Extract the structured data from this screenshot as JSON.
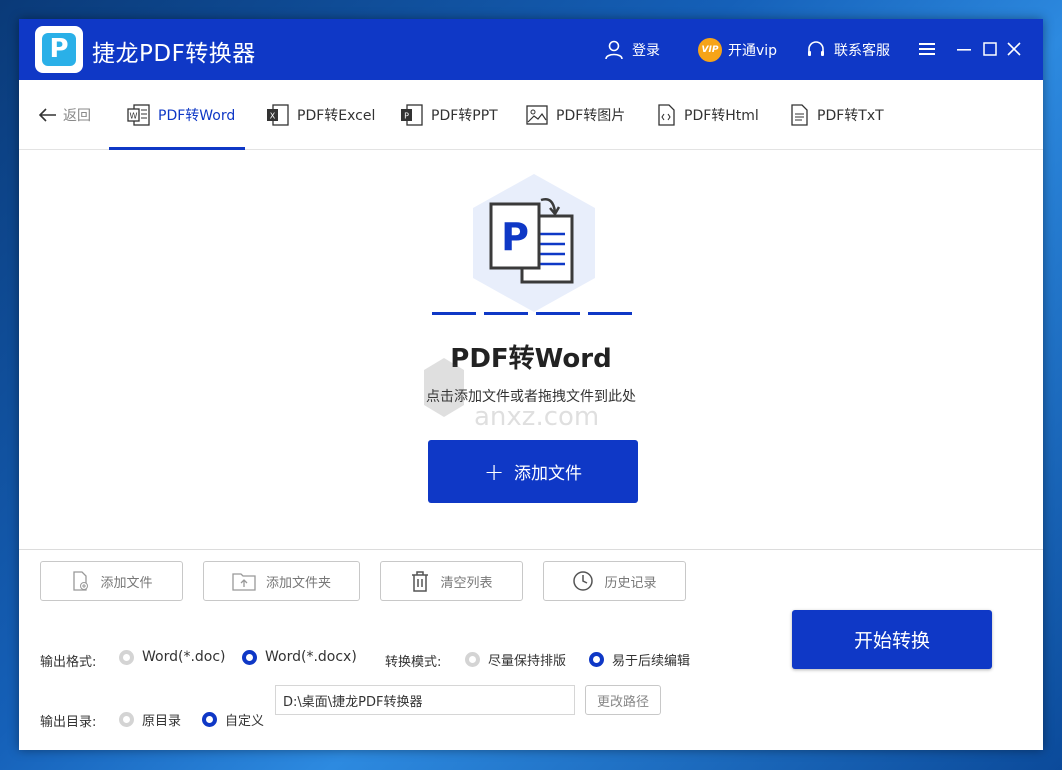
{
  "app": {
    "title": "捷龙PDF转换器",
    "logo_letter": "P"
  },
  "titlebar": {
    "login": "登录",
    "vip_badge": "VIP",
    "vip": "开通vip",
    "support": "联系客服"
  },
  "tabs": {
    "back": "返回",
    "items": [
      {
        "label": "PDF转Word",
        "icon": "word-icon",
        "active": true
      },
      {
        "label": "PDF转Excel",
        "icon": "excel-icon"
      },
      {
        "label": "PDF转PPT",
        "icon": "ppt-icon"
      },
      {
        "label": "PDF转图片",
        "icon": "image-icon"
      },
      {
        "label": "PDF转Html",
        "icon": "html-icon"
      },
      {
        "label": "PDF转TxT",
        "icon": "txt-icon"
      }
    ]
  },
  "drop": {
    "title": "PDF转Word",
    "subtitle": "点击添加文件或者拖拽文件到此处",
    "add_button": "添加文件",
    "watermark": "anxz.com"
  },
  "toolbar": {
    "add_file": "添加文件",
    "add_folder": "添加文件夹",
    "clear_list": "清空列表",
    "history": "历史记录"
  },
  "options": {
    "format_label": "输出格式:",
    "format_doc": "Word(*.doc)",
    "format_docx": "Word(*.docx)",
    "mode_label": "转换模式:",
    "mode_layout": "尽量保持排版",
    "mode_edit": "易于后续编辑",
    "dir_label": "输出目录:",
    "dir_original": "原目录",
    "dir_custom": "自定义",
    "dir_path": "D:\\桌面\\捷龙PDF转换器",
    "change_path": "更改路径",
    "start": "开始转换"
  },
  "colors": {
    "primary": "#0f38c6",
    "vip": "#f6a418",
    "logo": "#2ab0e8"
  }
}
